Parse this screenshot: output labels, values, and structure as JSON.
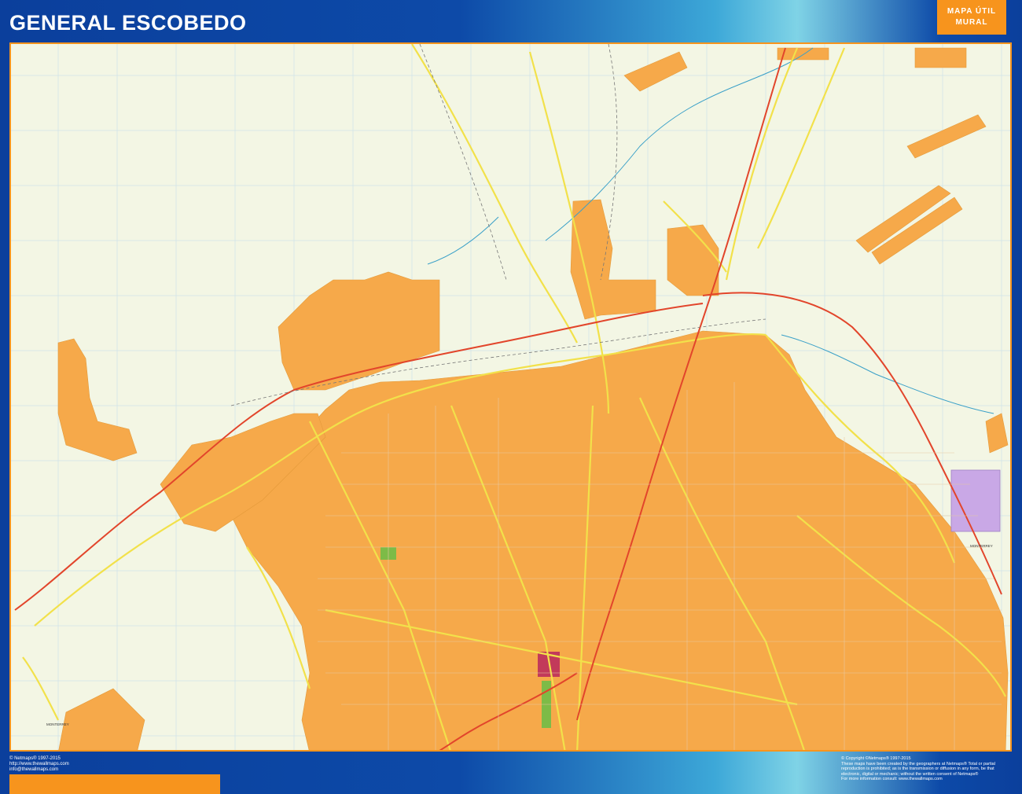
{
  "header": {
    "title": "GENERAL ESCOBEDO",
    "brand_line1": "MAPA ÚTIL",
    "brand_line2": "MURAL"
  },
  "map": {
    "labels": {
      "monterrey_east": "MONTERREY",
      "monterrey_south": "MONTERREY"
    }
  },
  "footer": {
    "left": [
      "© Netmaps® 1997-2015",
      "http://www.thewallmaps.com",
      "info@thewallmaps.com"
    ],
    "right": [
      "© Copyright ©Netmaps® 1997-2015",
      "These maps have been created by the geographers at Netmaps® Total or partial",
      "reproduction is prohibited; as is the transmission or diffusion in any form, be that",
      "electronic, digital or mechanic; without the written consent of Netmaps®",
      "For more information consult: www.thewallmaps.com"
    ]
  },
  "colors": {
    "frame_blue": "#0b3f9c",
    "accent_orange": "#f7941d",
    "urban_fill": "#f6a94a",
    "map_background": "#f3f6e4",
    "main_road": "#f2e14a",
    "highway": "#e2452b",
    "river": "#3aa0c8",
    "industrial_zone": "#c9a8e6"
  }
}
